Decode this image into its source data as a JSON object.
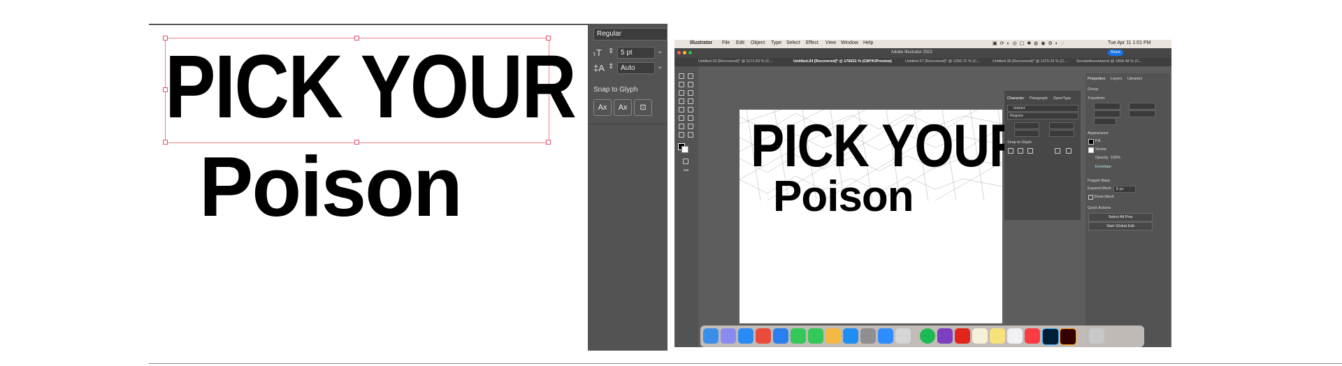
{
  "left_artboard": {
    "headline": "PICK YOUR",
    "subline": "Poison"
  },
  "character_panel": {
    "font_style": "Regular",
    "font_size": "5 pt",
    "leading": "Auto",
    "snap_to_glyph_label": "Snap to Glyph"
  },
  "screenshot": {
    "menu": [
      "Illustrator",
      "File",
      "Edit",
      "Object",
      "Type",
      "Select",
      "Effect",
      "View",
      "Window",
      "Help"
    ],
    "clock": "Tue Apr 11  1:01 PM",
    "window_title": "Adobe Illustrator 2023",
    "share_label": "Share",
    "tabs": [
      "Untitled-23 [Recovered]* @ 1171.63 % (C...",
      "Untitled-24 [Recovered]* @ 176631 % (CMYK/Preview)",
      "Untitled-27 [Recovered]* @ 1290.72 % (C...",
      "Untitled-30 [Recovered]* @ 1370.33 % (C...",
      "Socialvibesnetwork @ 1858.48 % (C..."
    ],
    "canvas_headline": "PICK YOUR",
    "canvas_subline": "Poison",
    "char_panel": {
      "tabs": [
        "Character",
        "Paragraph",
        "OpenType"
      ],
      "font": "Impact",
      "style": "Regular",
      "snap_label": "Snap to Glyph"
    },
    "properties": {
      "tabs": [
        "Properties",
        "Layers",
        "Libraries"
      ],
      "group_label": "Group",
      "transform_label": "Transform",
      "appearance_label": "Appearance",
      "fill_label": "Fill",
      "stroke_label": "Stroke",
      "opacity_label": "Opacity",
      "opacity_value": "100%",
      "envelope_label": "Envelope",
      "puppet_warp_label": "Puppet Warp",
      "expand_mesh_label": "Expand Mesh",
      "expand_mesh_value": "8 px",
      "show_mesh_label": "Show Mesh",
      "quick_actions_label": "Quick Actions",
      "select_all_pins": "Select All Pins",
      "start_global_edit": "Start Global Edit"
    }
  },
  "colors": {
    "ui_dark": "#535353",
    "accent_blue": "#1473e6",
    "selection": "#f08080"
  }
}
